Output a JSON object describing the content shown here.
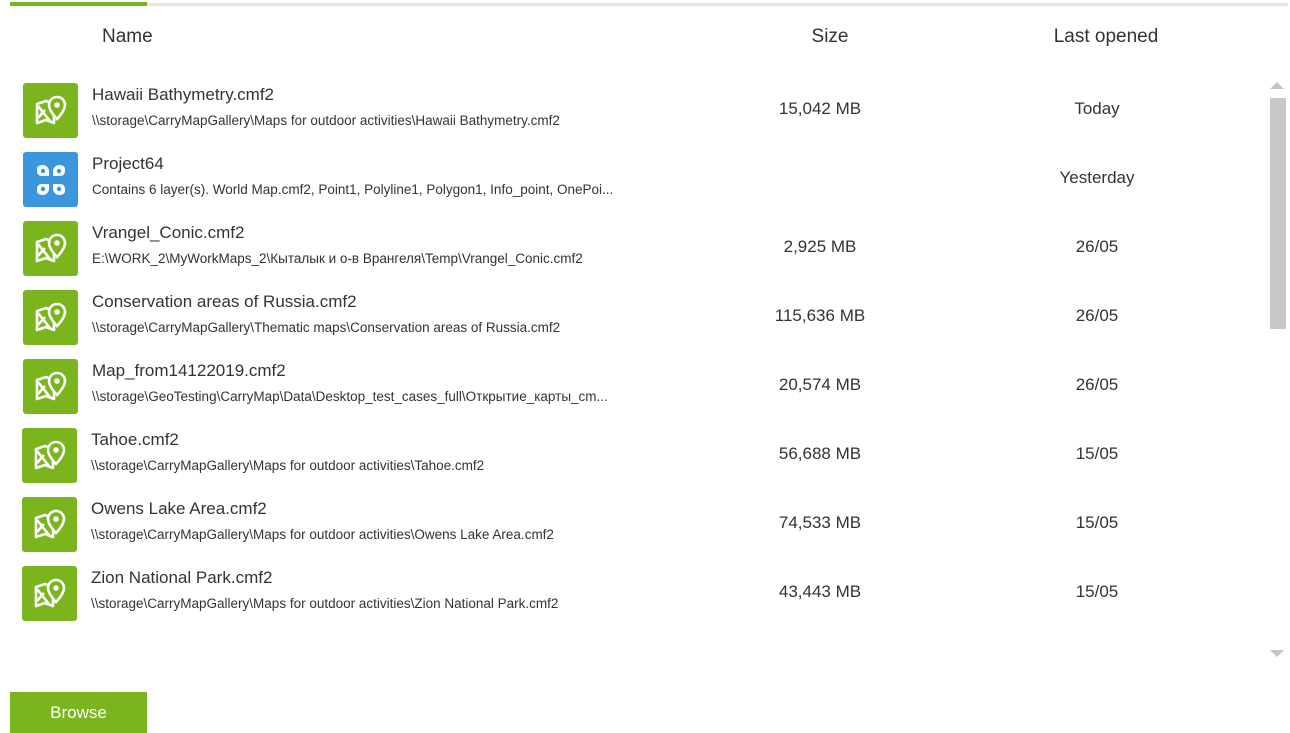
{
  "header": {
    "name_label": "Name",
    "size_label": "Size",
    "last_opened_label": "Last opened"
  },
  "colors": {
    "accent": "#7ab51d",
    "project_icon": "#3a96dd"
  },
  "rows": [
    {
      "icon": "map-pin-icon",
      "title": "Hawaii Bathymetry.cmf2",
      "path": "\\\\storage\\CarryMapGallery\\Maps for outdoor activities\\Hawaii Bathymetry.cmf2",
      "size": "15,042 MB",
      "last_opened": "Today"
    },
    {
      "icon": "project-icon",
      "title": "Project64",
      "path": "Contains 6 layer(s). World Map.cmf2, Point1, Polyline1, Polygon1, Info_point, OnePoi...",
      "size": "",
      "last_opened": "Yesterday"
    },
    {
      "icon": "map-pin-icon",
      "title": "Vrangel_Conic.cmf2",
      "path": "E:\\WORK_2\\MyWorkMaps_2\\Кыталык и о-в Врангеля\\Temp\\Vrangel_Conic.cmf2",
      "size": "2,925 MB",
      "last_opened": "26/05"
    },
    {
      "icon": "map-pin-icon",
      "title": "Conservation areas of Russia.cmf2",
      "path": "\\\\storage\\CarryMapGallery\\Thematic maps\\Conservation areas of Russia.cmf2",
      "size": "115,636 MB",
      "last_opened": "26/05"
    },
    {
      "icon": "map-pin-icon",
      "title": "Map_from14122019.cmf2",
      "path": "\\\\storage\\GeoTesting\\CarryMap\\Data\\Desktop_test_cases_full\\Открытие_карты_cm...",
      "size": "20,574 MB",
      "last_opened": "26/05"
    },
    {
      "icon": "map-pin-icon",
      "title": "Tahoe.cmf2",
      "path": "\\\\storage\\CarryMapGallery\\Maps for outdoor activities\\Tahoe.cmf2",
      "size": "56,688 MB",
      "last_opened": "15/05"
    },
    {
      "icon": "map-pin-icon",
      "title": "Owens Lake Area.cmf2",
      "path": "\\\\storage\\CarryMapGallery\\Maps for outdoor activities\\Owens Lake Area.cmf2",
      "size": "74,533 MB",
      "last_opened": "15/05"
    },
    {
      "icon": "map-pin-icon",
      "title": "Zion National Park.cmf2",
      "path": "\\\\storage\\CarryMapGallery\\Maps for outdoor activities\\Zion National Park.cmf2",
      "size": "43,443 MB",
      "last_opened": "15/05"
    }
  ],
  "browse_label": "Browse"
}
